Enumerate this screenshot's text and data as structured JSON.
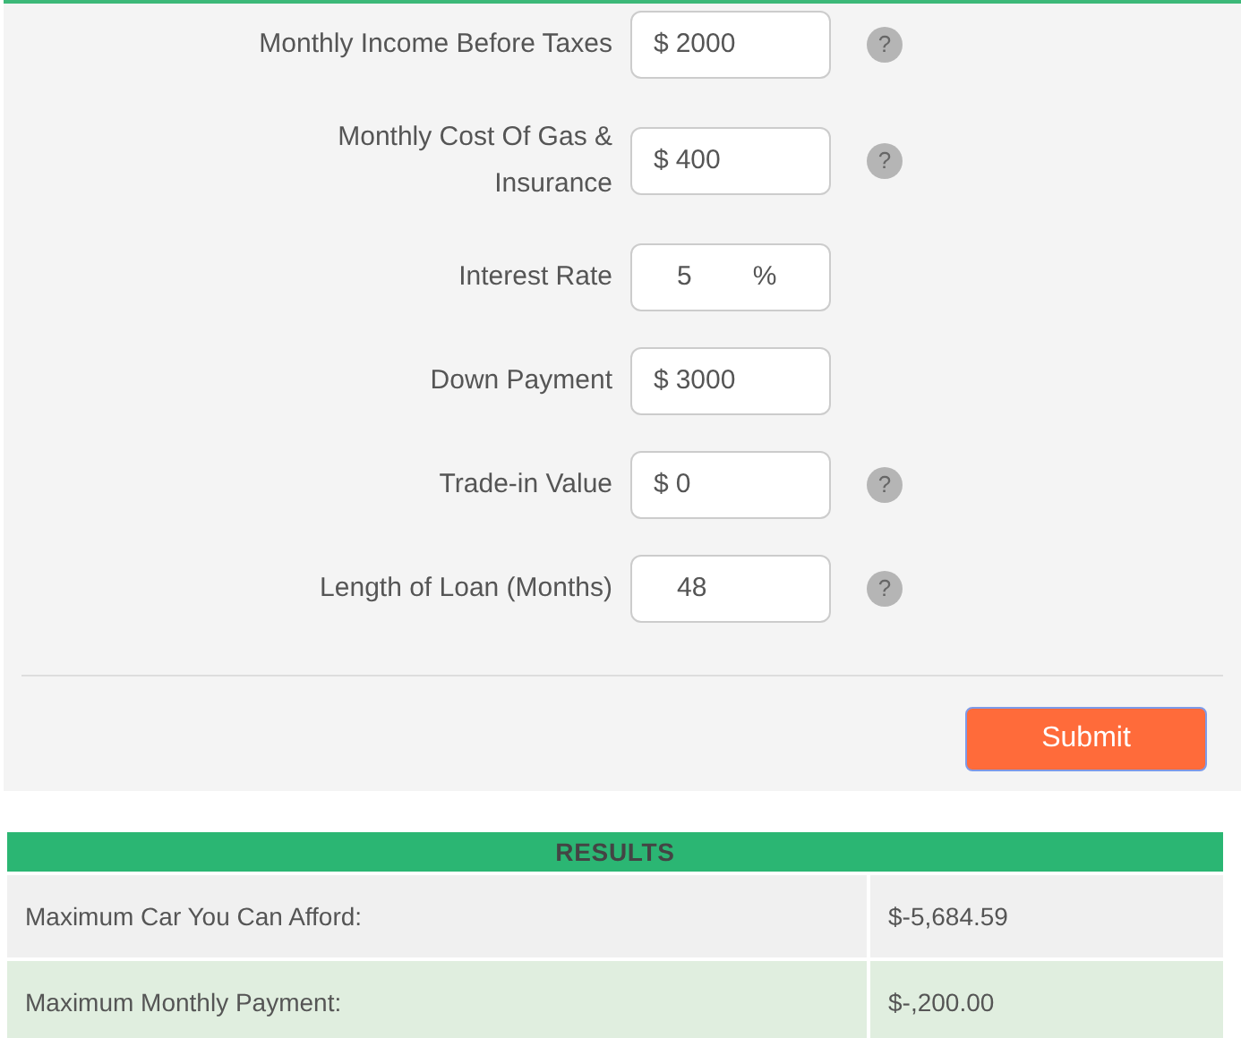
{
  "form": {
    "fields": [
      {
        "label": "Monthly Income Before Taxes",
        "prefix": "$",
        "value": "2000",
        "help": "?"
      },
      {
        "label": "Monthly Cost Of Gas & Insurance",
        "prefix": "$",
        "value": "400",
        "help": "?"
      },
      {
        "label": "Interest Rate",
        "value": "5",
        "suffix": "%"
      },
      {
        "label": "Down Payment",
        "prefix": "$",
        "value": "3000"
      },
      {
        "label": "Trade-in Value",
        "prefix": "$",
        "value": "0",
        "help": "?"
      },
      {
        "label": "Length of Loan (Months)",
        "value": "48",
        "help": "?"
      }
    ],
    "submit": "Submit"
  },
  "results": {
    "title": "RESULTS",
    "rows": [
      {
        "label": "Maximum Car You Can Afford:",
        "value": "$-5,684.59"
      },
      {
        "label": "Maximum Monthly Payment:",
        "value": "$-,200.00"
      }
    ]
  }
}
